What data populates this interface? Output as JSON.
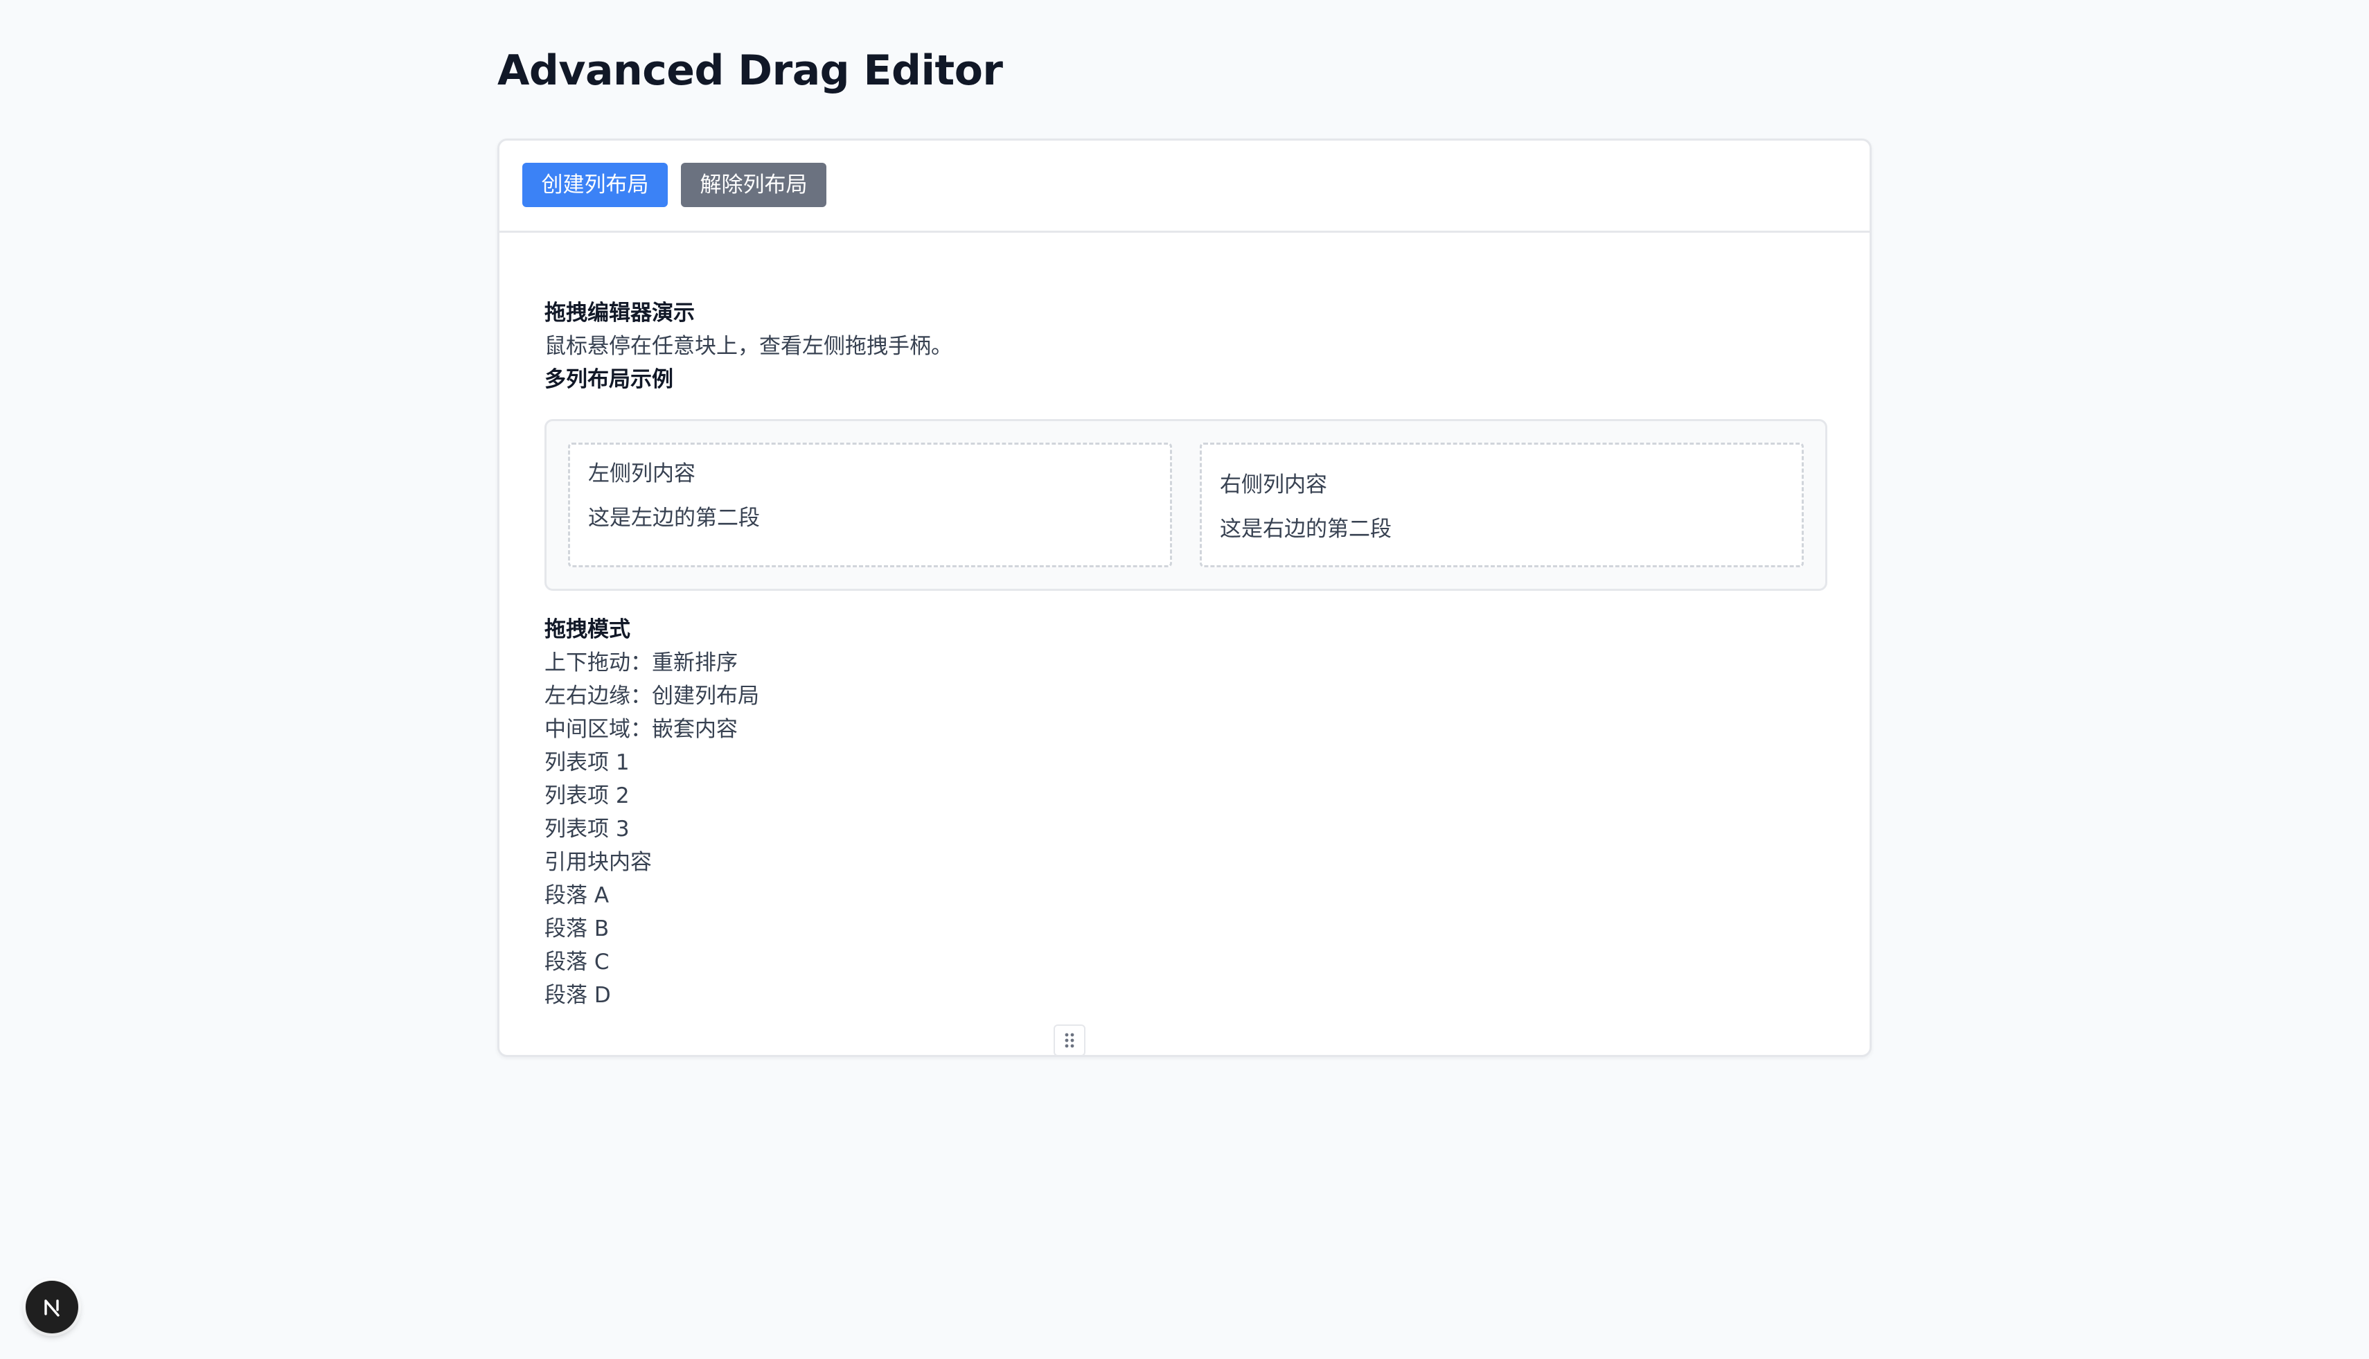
{
  "page": {
    "title": "Advanced Drag Editor"
  },
  "toolbar": {
    "create_columns_label": "创建列布局",
    "remove_columns_label": "解除列布局"
  },
  "editor": {
    "intro": [
      {
        "text": "拖拽编辑器演示",
        "bold": true
      },
      {
        "text": "鼠标悬停在任意块上，查看左侧拖拽手柄。",
        "bold": false
      },
      {
        "text": "多列布局示例",
        "bold": true
      }
    ],
    "columns": {
      "left": [
        "左侧列内容",
        "这是左边的第二段"
      ],
      "right": [
        "右侧列内容",
        "这是右边的第二段"
      ]
    },
    "blocks": [
      {
        "text": "拖拽模式",
        "bold": true
      },
      {
        "text": "上下拖动：重新排序",
        "bold": false
      },
      {
        "text": "左右边缘：创建列布局",
        "bold": false
      },
      {
        "text": "中间区域：嵌套内容",
        "bold": false
      },
      {
        "text": "列表项 1",
        "bold": false
      },
      {
        "text": "列表项 2",
        "bold": false
      },
      {
        "text": "列表项 3",
        "bold": false
      },
      {
        "text": "引用块内容",
        "bold": false
      },
      {
        "text": "段落 A",
        "bold": false
      },
      {
        "text": "段落 B",
        "bold": false
      },
      {
        "text": "段落 C",
        "bold": false
      },
      {
        "text": "段落 D",
        "bold": false
      }
    ]
  },
  "icons": {
    "drag_handle": "drag-handle-icon",
    "dev_badge": "nextjs-logo-icon"
  },
  "colors": {
    "primary": "#3b82f6",
    "secondary": "#6b7280",
    "background": "#f8fafc",
    "border": "#e5e7eb"
  }
}
